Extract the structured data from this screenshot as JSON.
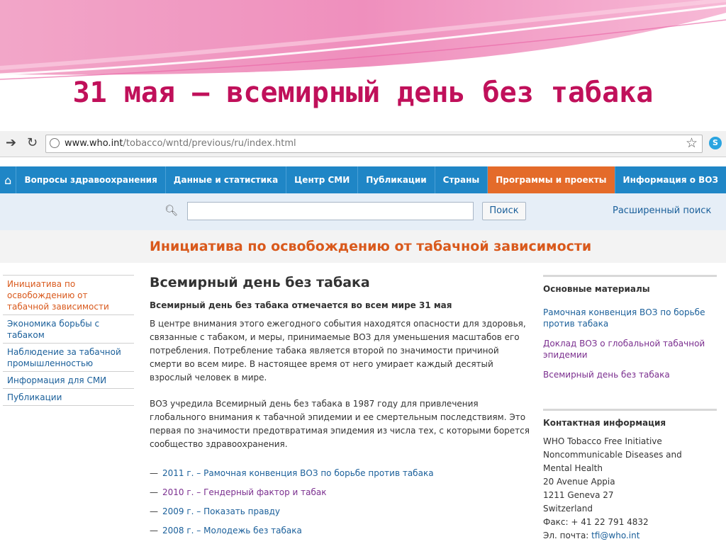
{
  "slide": {
    "title": "31 мая – всемирный день без табака"
  },
  "browser": {
    "url_host": "www.who.int",
    "url_path": "/tobacco/wntd/previous/ru/index.html"
  },
  "nav": {
    "items": [
      {
        "label": "Вопросы здравоохранения"
      },
      {
        "label": "Данные и статистика"
      },
      {
        "label": "Центр СМИ"
      },
      {
        "label": "Публикации"
      },
      {
        "label": "Страны"
      },
      {
        "label": "Программы и проекты"
      },
      {
        "label": "Информация о ВОЗ"
      }
    ]
  },
  "search": {
    "value": "",
    "button": "Поиск",
    "advanced": "Расширенный поиск"
  },
  "section": {
    "title": "Инициатива по освобождению от табачной зависимости"
  },
  "sidebar": {
    "items": [
      {
        "label": "Инициатива по освобождению от табачной зависимости"
      },
      {
        "label": "Экономика борьбы с табаком"
      },
      {
        "label": "Наблюдение за табачной промышленностью"
      },
      {
        "label": "Информация для СМИ"
      },
      {
        "label": "Публикации"
      }
    ]
  },
  "main": {
    "heading": "Всемирный день без табака",
    "lead": "Всемирный день без табака отмечается во всем мире 31 мая",
    "para1": "В центре внимания этого ежегодного события находятся опасности для здоровья, связанные с табаком, и меры, принимаемые ВОЗ для уменьшения масштабов его потребления. Потребление табака является второй по значимости причиной смерти во всем мире. В настоящее время от него умирает каждый десятый взрослый человек в мире.",
    "para2": "ВОЗ учредила Всемирный день без табака в 1987 году для привлечения глобального внимания к табачной эпидемии и ее смертельным последствиям. Это первая по значимости предотвратимая эпидемия из числа тех, с которыми борется сообщество здравоохранения.",
    "links": [
      {
        "label": "2011 г. – Рамочная конвенция ВОЗ по борьбе против табака"
      },
      {
        "label": "2010 г. – Гендерный фактор и табак"
      },
      {
        "label": "2009 г. – Показать правду"
      },
      {
        "label": "2008 г. – Молодежь без табака"
      }
    ]
  },
  "right": {
    "materials_heading": "Основные материалы",
    "materials": [
      {
        "label": "Рамочная конвенция ВОЗ по борьбе против табака"
      },
      {
        "label": "Доклад ВОЗ о глобальной табачной эпидемии"
      },
      {
        "label": "Всемирный день без табака"
      }
    ],
    "contact_heading": "Контактная информация",
    "contact_lines": [
      "WHO Tobacco Free Initiative",
      "Noncommunicable Diseases and",
      "Mental Health",
      "20 Avenue Appia",
      "1211 Geneva 27",
      "Switzerland",
      "Факс: + 41 22 791 4832"
    ],
    "email_label": "Эл. почта: ",
    "email": "tfi@who.int"
  },
  "colors": {
    "slide_title": "#c0105a",
    "nav_blue": "#1f86c6",
    "nav_active": "#e46b2a",
    "section_orange": "#d9591c",
    "link": "#1a5f9a",
    "visited": "#7b2f8f"
  },
  "icons": {
    "back": "back-arrow-icon",
    "reload": "reload-icon",
    "site": "globe-icon",
    "bookmark": "star-icon",
    "skype": "skype-icon",
    "home": "home-icon",
    "search": "magnifier-icon"
  }
}
